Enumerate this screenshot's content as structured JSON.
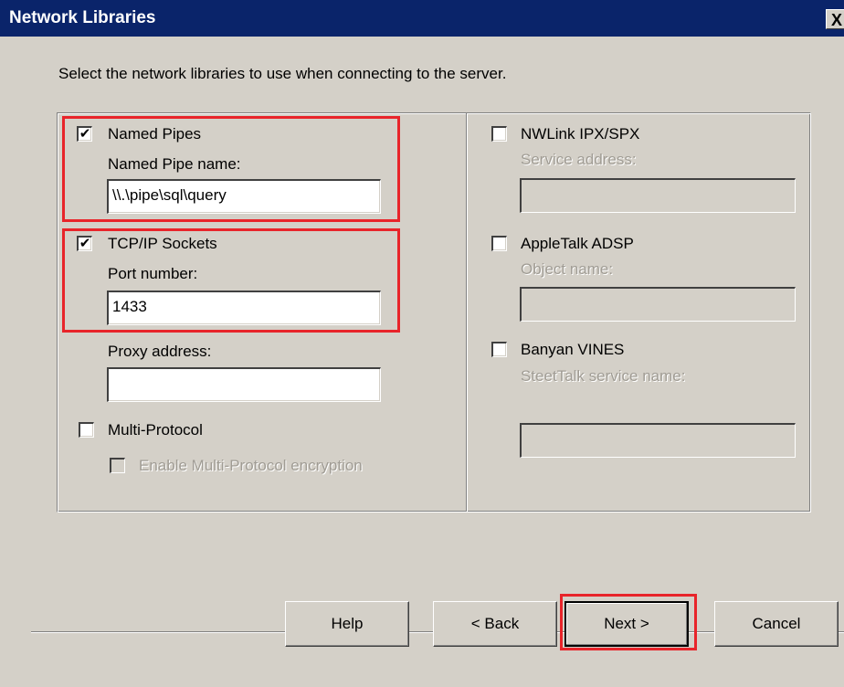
{
  "window": {
    "title": "Network Libraries",
    "close_glyph": "X"
  },
  "instruction": "Select the network libraries to use when connecting to the server.",
  "left": {
    "named_pipes": {
      "label": "Named Pipes",
      "checked": true,
      "field_label": "Named Pipe name:",
      "value": "\\\\.\\pipe\\sql\\query"
    },
    "tcpip": {
      "label": "TCP/IP Sockets",
      "checked": true,
      "port_label": "Port number:",
      "port_value": "1433",
      "proxy_label": "Proxy address:",
      "proxy_value": ""
    },
    "multi_protocol": {
      "label": "Multi-Protocol",
      "checked": false,
      "encryption_label": "Enable Multi-Protocol encryption",
      "encryption_checked": false
    }
  },
  "right": {
    "nwlink": {
      "label": "NWLink IPX/SPX",
      "checked": false,
      "field_label": "Service address:",
      "value": ""
    },
    "appletalk": {
      "label": "AppleTalk ADSP",
      "checked": false,
      "field_label": "Object name:",
      "value": ""
    },
    "banyan": {
      "label": "Banyan VINES",
      "checked": false,
      "field_label": "SteetTalk service name:",
      "value": ""
    }
  },
  "buttons": {
    "help": "Help",
    "back": "< Back",
    "next": "Next >",
    "cancel": "Cancel"
  },
  "colors": {
    "titlebar": "#0a246a",
    "highlight": "#e8242a",
    "face": "#d4d0c8"
  },
  "checkmark_glyph": "✔"
}
